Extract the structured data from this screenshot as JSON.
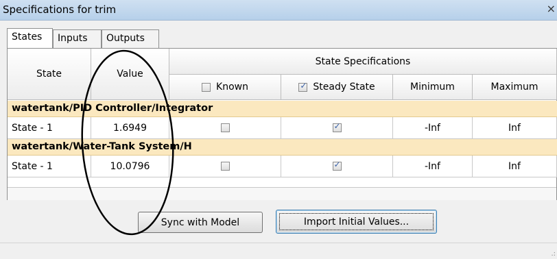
{
  "window": {
    "title": "Specifications for trim",
    "close_glyph": "×"
  },
  "tabs": [
    {
      "label": "States",
      "active": true
    },
    {
      "label": "Inputs",
      "active": false
    },
    {
      "label": "Outputs",
      "active": false
    }
  ],
  "table": {
    "headers": {
      "state": "State",
      "value": "Value",
      "group": "State Specifications",
      "known": "Known",
      "steady": "Steady State",
      "minimum": "Minimum",
      "maximum": "Maximum"
    },
    "header_checks": {
      "known": false,
      "steady": true
    },
    "blocks": [
      {
        "name": "watertank/PID Controller/Integrator",
        "row": {
          "state": "State - 1",
          "value": "1.6949",
          "known": false,
          "steady": true,
          "minimum": "-Inf",
          "maximum": "Inf"
        }
      },
      {
        "name": "watertank/Water-Tank System/H",
        "row": {
          "state": "State - 1",
          "value": "10.0796",
          "known": false,
          "steady": true,
          "minimum": "-Inf",
          "maximum": "Inf"
        }
      }
    ]
  },
  "buttons": {
    "sync": "Sync with Model",
    "import": "Import Initial Values..."
  },
  "check_glyph": "✓",
  "grip_glyph": ".:",
  "colors": {
    "group_row": "#fbe8bf",
    "annotation_ellipse": "#000000"
  }
}
